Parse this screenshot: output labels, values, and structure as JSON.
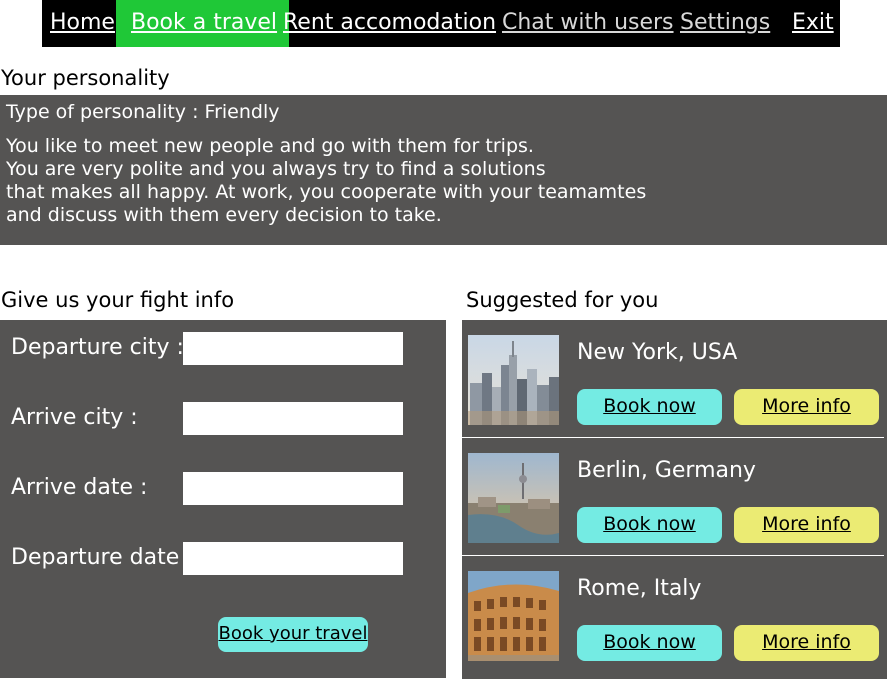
{
  "nav": {
    "items": [
      {
        "label": "Home"
      },
      {
        "label": "Book a travel",
        "active": true
      },
      {
        "label": "Rent accomodation"
      },
      {
        "label": "Chat with users"
      },
      {
        "label": "Settings"
      },
      {
        "label": "Exit"
      }
    ],
    "active_color": "#1fc837",
    "background": "#000000"
  },
  "personality": {
    "heading": "Your personality",
    "type_label": "Type of personality : Friendly",
    "description_lines": [
      "You like to meet new people and go with them for trips.",
      "You are very polite and you always try to find a solutions",
      "that makes all happy. At work, you cooperate with your teamamtes",
      "and discuss with them every decision to take."
    ]
  },
  "flight_form": {
    "heading": "Give us your fight info",
    "fields": [
      {
        "label": "Departure city :",
        "value": ""
      },
      {
        "label": "Arrive city :",
        "value": ""
      },
      {
        "label": "Arrive date :",
        "value": ""
      },
      {
        "label": "Departure date :",
        "value": ""
      }
    ],
    "submit_label": "Book your travel"
  },
  "suggestions": {
    "heading": "Suggested for you",
    "items": [
      {
        "city": "New York, USA",
        "image": "new-york-skyline",
        "book_label": "Book now",
        "info_label": "More info"
      },
      {
        "city": "Berlin, Germany",
        "image": "berlin-cityscape",
        "book_label": "Book now",
        "info_label": "More info"
      },
      {
        "city": "Rome, Italy",
        "image": "rome-colosseum",
        "book_label": "Book now",
        "info_label": "More info"
      }
    ]
  },
  "colors": {
    "panel_bg": "#555453",
    "book_button": "#74ebe3",
    "info_button": "#ebeb73"
  }
}
